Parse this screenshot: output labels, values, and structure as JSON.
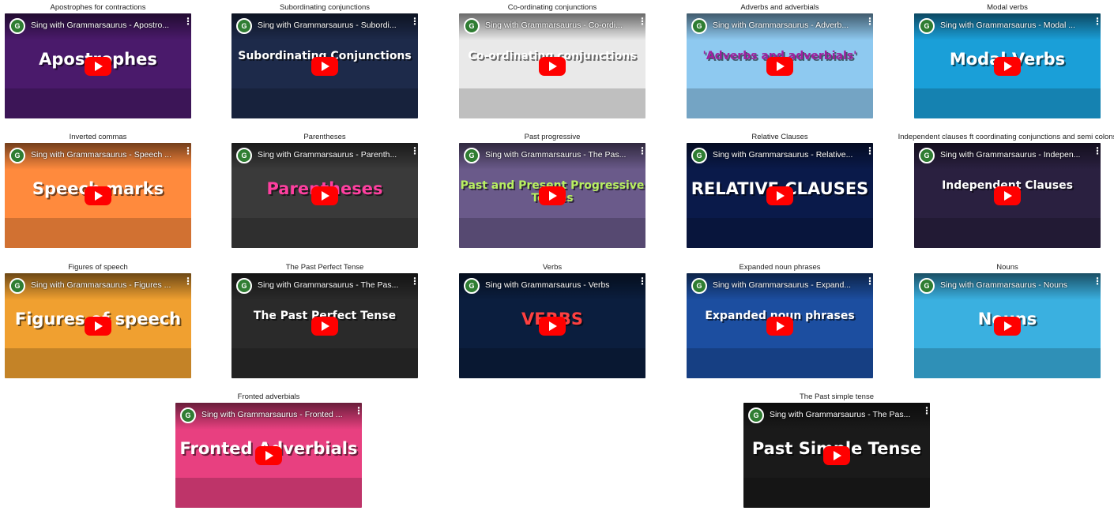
{
  "videos": [
    {
      "caption": "Apostrophes for contractions",
      "title": "Sing with Grammarsaurus - Apostro...",
      "art": "Apostrophes",
      "bg": "#4a1a6b",
      "art_color": "#ffffff"
    },
    {
      "caption": "Subordinating conjunctions",
      "title": "Sing with Grammarsaurus - Subordi...",
      "art": "Subordinating Conjunctions",
      "bg": "#1d2a4a",
      "art_color": "#ffffff"
    },
    {
      "caption": "Co-ordinating conjunctions",
      "title": "Sing with Grammarsaurus - Co-ordi...",
      "art": "Co-ordinating conjunctions",
      "bg": "#e9e9e9",
      "art_color": "#ffffff"
    },
    {
      "caption": "Adverbs and adverbials",
      "title": "Sing with Grammarsaurus - Adverb...",
      "art": "'Adverbs and adverbials'",
      "bg": "#8ec9f0",
      "art_color": "#a020a0"
    },
    {
      "caption": "Modal verbs",
      "title": "Sing with Grammarsaurus - Modal ...",
      "art": "Modal Verbs",
      "bg": "#1a9fd8",
      "art_color": "#ffffff"
    },
    {
      "caption": "Inverted commas",
      "title": "Sing with Grammarsaurus - Speech ...",
      "art": "Speech marks",
      "bg": "#ff8a3d",
      "art_color": "#ffffff"
    },
    {
      "caption": "Parentheses",
      "title": "Sing with Grammarsaurus - Parenth...",
      "art": "Parentheses",
      "bg": "#3a3a3a",
      "art_color": "#ff3fa0"
    },
    {
      "caption": "Past progressive",
      "title": "Sing with Grammarsaurus - The Pas...",
      "art": "Past and Present Progressive Tenses",
      "bg": "#6a5a8a",
      "art_color": "#b8f060"
    },
    {
      "caption": "Relative Clauses",
      "title": "Sing with Grammarsaurus - Relative...",
      "art": "RELATIVE CLAUSES",
      "bg": "#0a1a4a",
      "art_color": "#ffffff"
    },
    {
      "caption": "Independent clauses ft coordinating conjunctions and semi colons",
      "title": "Sing with Grammarsaurus - Indepen...",
      "art": "Independent Clauses",
      "bg": "#2a2040",
      "art_color": "#ffffff"
    },
    {
      "caption": "Figures of speech",
      "title": "Sing with Grammarsaurus - Figures ...",
      "art": "Figures of speech",
      "bg": "#f0a030",
      "art_color": "#ffffff"
    },
    {
      "caption": "The Past Perfect Tense",
      "title": "Sing with Grammarsaurus - The Pas...",
      "art": "The Past Perfect Tense",
      "bg": "#2a2a2a",
      "art_color": "#ffffff"
    },
    {
      "caption": "Verbs",
      "title": "Sing with Grammarsaurus - Verbs",
      "art": "VERBS",
      "bg": "#0b1e3e",
      "art_color": "#ff4040"
    },
    {
      "caption": "Expanded noun phrases",
      "title": "Sing with Grammarsaurus - Expand...",
      "art": "Expanded noun phrases",
      "bg": "#1c4ea0",
      "art_color": "#ffffff"
    },
    {
      "caption": "Nouns",
      "title": "Sing with Grammarsaurus - Nouns",
      "art": "Nouns",
      "bg": "#3ab0e0",
      "art_color": "#ffffff"
    },
    {
      "caption": "Fronted adverbials",
      "title": "Sing with Grammarsaurus - Fronted ...",
      "art": "Fronted Adverbials",
      "bg": "#e84080",
      "art_color": "#ffffff"
    },
    {
      "caption": "The Past simple tense",
      "title": "Sing with Grammarsaurus - The Pas...",
      "art": "Past Simple Tense",
      "bg": "#1a1a1a",
      "art_color": "#ffffff"
    }
  ],
  "channel_initial": "G"
}
